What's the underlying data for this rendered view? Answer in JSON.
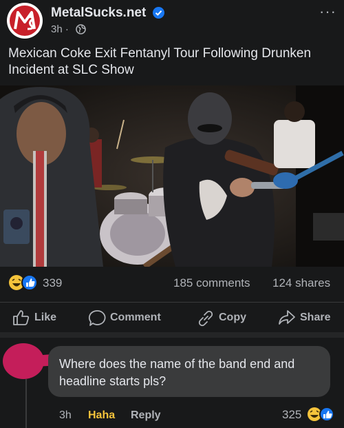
{
  "post": {
    "page_name": "MetalSucks.net",
    "time": "3h",
    "separator": "·",
    "more": "···",
    "text": "Mexican Coke Exit Fentanyl Tour Following Drunken Incident at SLC Show"
  },
  "stats": {
    "reactions": "339",
    "comments": "185 comments",
    "shares": "124 shares"
  },
  "actions": {
    "like": "Like",
    "comment": "Comment",
    "copy": "Copy",
    "share": "Share"
  },
  "comment": {
    "text": "Where does the name of the band end and headline starts pls?",
    "time": "3h",
    "reaction_label": "Haha",
    "reply_label": "Reply",
    "reaction_count": "325"
  },
  "icons": [
    "verified-icon",
    "globe-icon",
    "haha-reaction-icon",
    "like-reaction-icon",
    "thumbs-up-icon",
    "speech-bubble-icon",
    "link-icon",
    "share-arrow-icon"
  ],
  "colors": {
    "background": "#18191a",
    "text": "#e4e6eb",
    "secondary_text": "#b0b3b8",
    "facebook_blue": "#1877f2",
    "haha_yellow": "#f5c33b",
    "logo_red": "#c8202a",
    "redaction": "#c41e5a"
  }
}
